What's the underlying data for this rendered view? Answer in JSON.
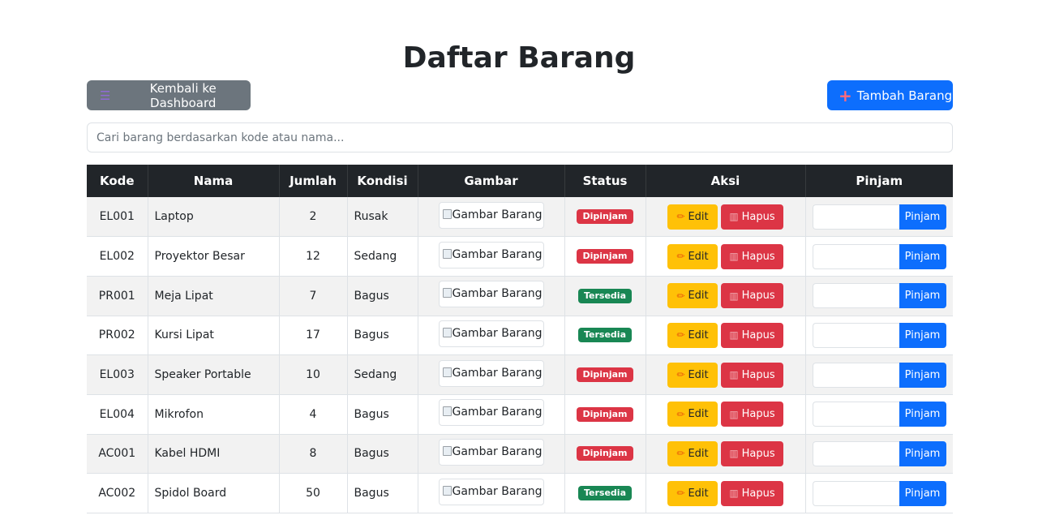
{
  "page": {
    "title": "Daftar Barang",
    "back_label": "Kembali ke Dashboard",
    "add_label": "Tambah Barang",
    "search_placeholder": "Cari barang berdasarkan kode atau nama..."
  },
  "table": {
    "headers": [
      "Kode",
      "Nama",
      "Jumlah",
      "Kondisi",
      "Gambar",
      "Status",
      "Aksi",
      "Pinjam"
    ],
    "rows": [
      {
        "kode": "EL001",
        "nama": "Laptop",
        "jumlah": "2",
        "kondisi": "Rusak",
        "gambar": "Gambar Barang",
        "status": "Dipinjam"
      },
      {
        "kode": "EL002",
        "nama": "Proyektor Besar",
        "jumlah": "12",
        "kondisi": "Sedang",
        "gambar": "Gambar Barang",
        "status": "Dipinjam"
      },
      {
        "kode": "PR001",
        "nama": "Meja Lipat",
        "jumlah": "7",
        "kondisi": "Bagus",
        "gambar": "Gambar Barang",
        "status": "Tersedia"
      },
      {
        "kode": "PR002",
        "nama": "Kursi Lipat",
        "jumlah": "17",
        "kondisi": "Bagus",
        "gambar": "Gambar Barang",
        "status": "Tersedia"
      },
      {
        "kode": "EL003",
        "nama": "Speaker Portable",
        "jumlah": "10",
        "kondisi": "Sedang",
        "gambar": "Gambar Barang",
        "status": "Dipinjam"
      },
      {
        "kode": "EL004",
        "nama": "Mikrofon",
        "jumlah": "4",
        "kondisi": "Bagus",
        "gambar": "Gambar Barang",
        "status": "Dipinjam"
      },
      {
        "kode": "AC001",
        "nama": "Kabel HDMI",
        "jumlah": "8",
        "kondisi": "Bagus",
        "gambar": "Gambar Barang",
        "status": "Dipinjam"
      },
      {
        "kode": "AC002",
        "nama": "Spidol Board",
        "jumlah": "50",
        "kondisi": "Bagus",
        "gambar": "Gambar Barang",
        "status": "Tersedia"
      }
    ],
    "edit_label": "Edit",
    "delete_label": "Hapus",
    "pinjam_label": "Pinjam"
  },
  "colors": {
    "primary": "#0d6efd",
    "secondary": "#6c757d",
    "warning": "#ffc107",
    "danger": "#dc3545",
    "success": "#198754",
    "header_dark": "#212529"
  },
  "icons": {
    "back": "list-icon",
    "add": "plus-icon",
    "edit": "pencil-icon",
    "delete": "trash-icon"
  }
}
